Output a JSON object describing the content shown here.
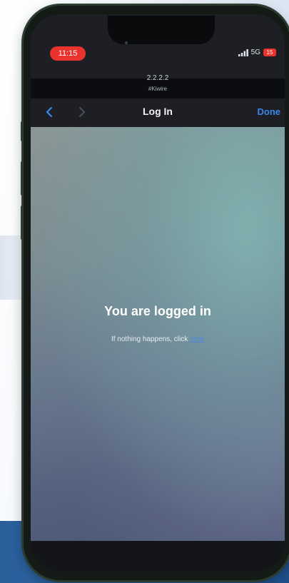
{
  "status_bar": {
    "time": "11:15",
    "network": "5G",
    "battery": "15"
  },
  "browser": {
    "url": "2.2.2.2",
    "site_name": "#Kiwire",
    "title": "Log In",
    "done_label": "Done"
  },
  "page": {
    "headline": "You are logged in",
    "message": "If nothing happens, click",
    "link_text": "here"
  },
  "colors": {
    "accent": "#3a86e8",
    "time_pill": "#e9332c",
    "battery": "#e9332c"
  }
}
